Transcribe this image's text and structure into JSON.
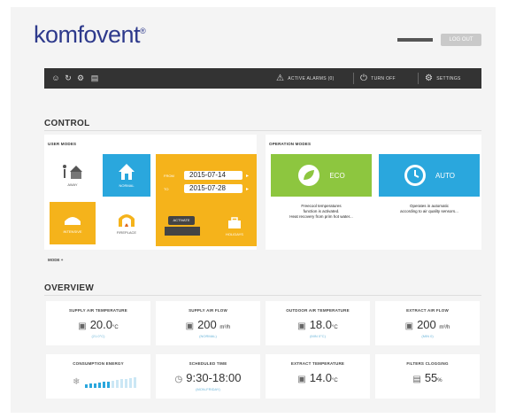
{
  "header": {
    "logo": "komfovent",
    "language": "ENGLISH",
    "logout_label": "LOG OUT"
  },
  "topbar": {
    "left_icons": [
      "person-icon",
      "refresh-icon",
      "settings-icon",
      "document-icon"
    ],
    "alarms_label": "ACTIVE ALARMS (0)",
    "turn_off_label": "TURN OFF",
    "settings_label": "SETTINGS"
  },
  "control": {
    "title": "CONTROL",
    "user_modes_label": "USER MODES",
    "modes": [
      {
        "name": "AWAY",
        "color": "#ffffff"
      },
      {
        "name": "NORMAL",
        "color": "#2aa7dd"
      },
      {
        "name": "INTENSIVE",
        "color": "#f5b31b"
      },
      {
        "name": "FIREPLACE",
        "color": "#ffffff"
      }
    ],
    "holiday": {
      "from_label": "FROM",
      "from_value": "2015-07-14",
      "to_label": "TO",
      "to_value": "2015-07-28",
      "set_label": "ACTIVATE",
      "caption": "HOLIDAYS"
    },
    "more_label": "MODE +",
    "operation_modes_label": "OPERATION MODES",
    "eco": {
      "label": "ECO",
      "color": "#8dc63f",
      "note": "Freecool temperatures\nfunction is activated.\nHeat recovery from prim hot water..."
    },
    "auto": {
      "label": "AUTO",
      "color": "#2aa7dd",
      "note": "Operates in automatic\naccording to air quality sensors..."
    }
  },
  "overview": {
    "title": "OVERVIEW",
    "cards": [
      {
        "title": "SUPPLY AIR TEMPERATURE",
        "value": "20.0",
        "unit": "°C",
        "sub": "(21.0°C)",
        "icon": "thermometer-icon"
      },
      {
        "title": "SUPPLY AIR FLOW",
        "value": "200",
        "unit": "m³/h",
        "sub": "(NORMAL)",
        "icon": "fan-icon"
      },
      {
        "title": "OUTDOOR AIR TEMPERATURE",
        "value": "18.0",
        "unit": "°C",
        "sub": "(MIN 0°C)",
        "icon": "thermometer-icon"
      },
      {
        "title": "EXTRACT AIR FLOW",
        "value": "200",
        "unit": "m³/h",
        "sub": "(MIN 0)",
        "icon": "fan-icon"
      },
      {
        "title": "CONSUMPTION ENERGY",
        "value": "",
        "unit": "",
        "sub": "",
        "icon": "level-icon",
        "level": 0.55
      },
      {
        "title": "SCHEDULED TIME",
        "value": "9:30-18:00",
        "unit": "",
        "sub": "(MON-FRIDAY)",
        "icon": "clock-icon"
      },
      {
        "title": "EXTRACT TEMPERATURE",
        "value": "14.0",
        "unit": "°C",
        "sub": "",
        "icon": "thermometer-icon"
      },
      {
        "title": "FILTERS CLOGGING",
        "value": "55",
        "unit": "%",
        "sub": "",
        "icon": "filter-icon"
      }
    ]
  }
}
